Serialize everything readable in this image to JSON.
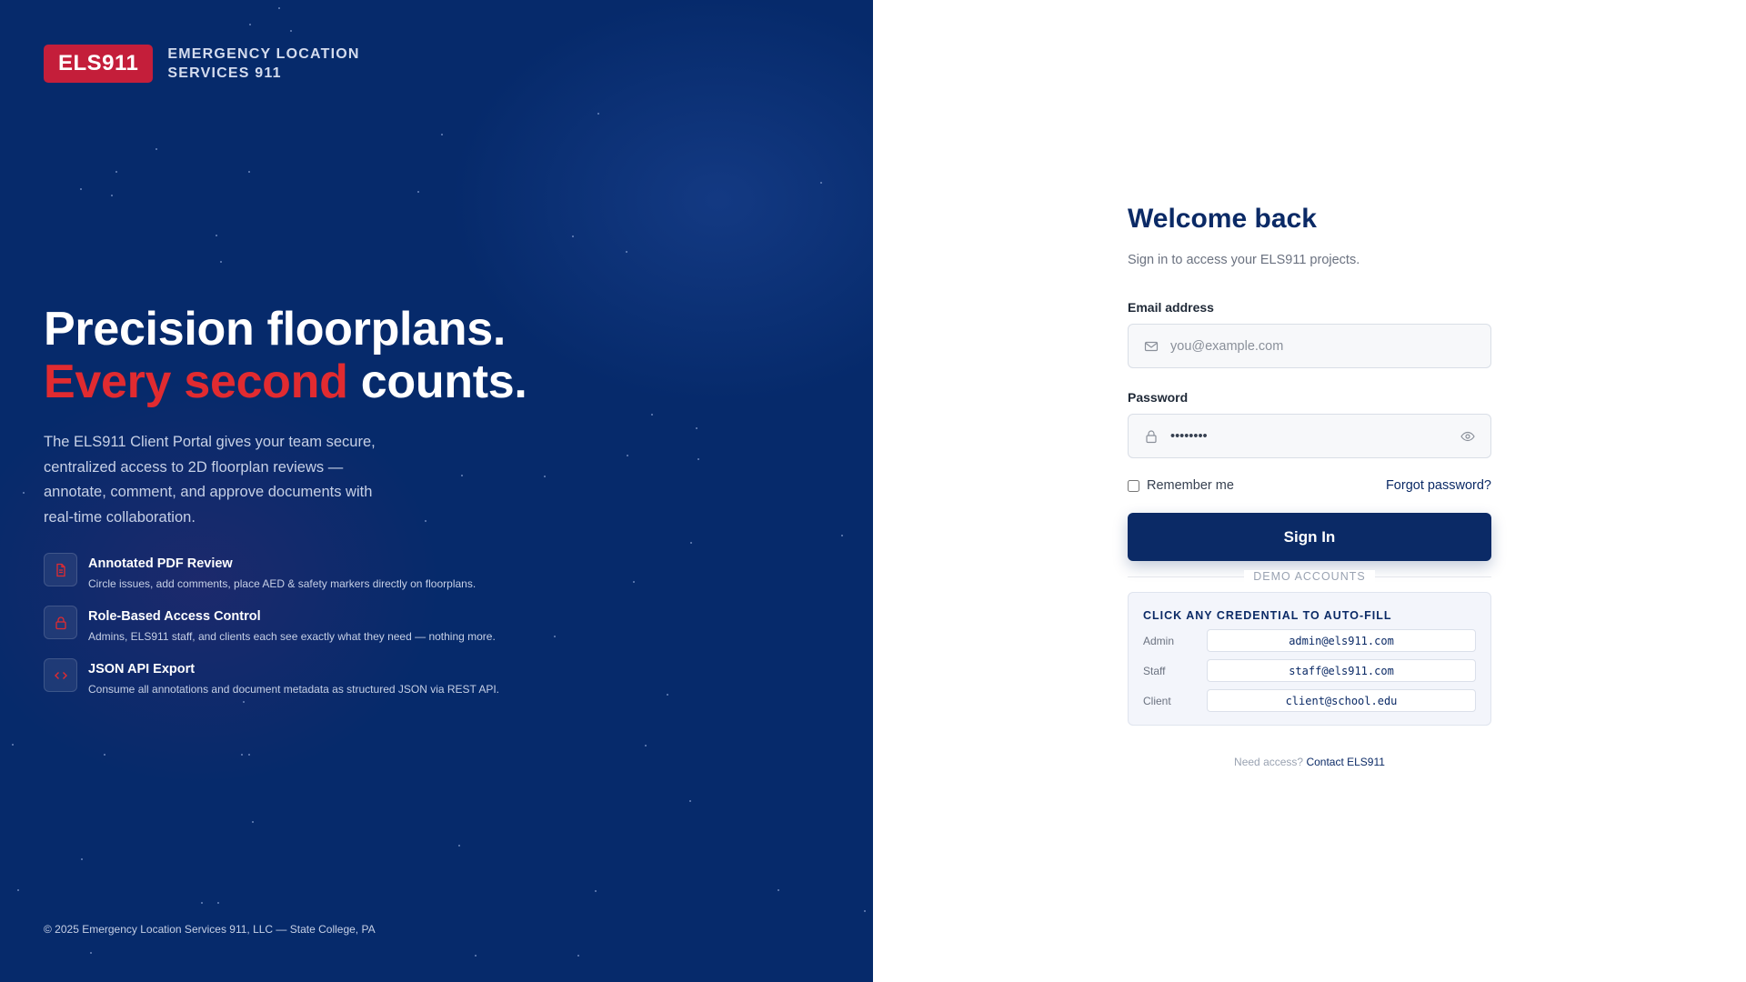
{
  "brand": {
    "badge": "ELS911",
    "name": "EMERGENCY LOCATION SERVICES 911"
  },
  "hero": {
    "line1": "Precision floorplans.",
    "line2_accent": "Every second",
    "line2_rest": "counts.",
    "description": "The ELS911 Client Portal gives your team secure, centralized access to 2D floorplan reviews — annotate, comment, and approve documents with real-time collaboration."
  },
  "features": [
    {
      "icon": "document-icon",
      "title": "Annotated PDF Review",
      "description": "Circle issues, add comments, place AED & safety markers directly on floorplans."
    },
    {
      "icon": "lock-icon",
      "title": "Role-Based Access Control",
      "description": "Admins, ELS911 staff, and clients each see exactly what they need — nothing more."
    },
    {
      "icon": "code-icon",
      "title": "JSON API Export",
      "description": "Consume all annotations and document metadata as structured JSON via REST API."
    }
  ],
  "footer": {
    "copyright": "© 2025 Emergency Location Services 911, LLC — State College, PA"
  },
  "login": {
    "title": "Welcome back",
    "subtitle": "Sign in to access your ELS911 projects.",
    "email_label": "Email address",
    "email_placeholder": "you@example.com",
    "email_value": "",
    "password_label": "Password",
    "password_value": "••••••••",
    "remember_label": "Remember me",
    "forgot_label": "Forgot password?",
    "signin_label": "Sign In"
  },
  "demo": {
    "divider": "DEMO ACCOUNTS",
    "heading": "CLICK ANY CREDENTIAL TO AUTO-FILL",
    "accounts": [
      {
        "role": "Admin",
        "email": "admin@els911.com"
      },
      {
        "role": "Staff",
        "email": "staff@els911.com"
      },
      {
        "role": "Client",
        "email": "client@school.edu"
      }
    ]
  },
  "access": {
    "prompt": "Need access?",
    "link": "Contact ELS911"
  },
  "colors": {
    "navy": "#062a6b",
    "brand_red": "#c41e3a",
    "accent_red": "#e12b30",
    "button": "#0b2a66"
  }
}
